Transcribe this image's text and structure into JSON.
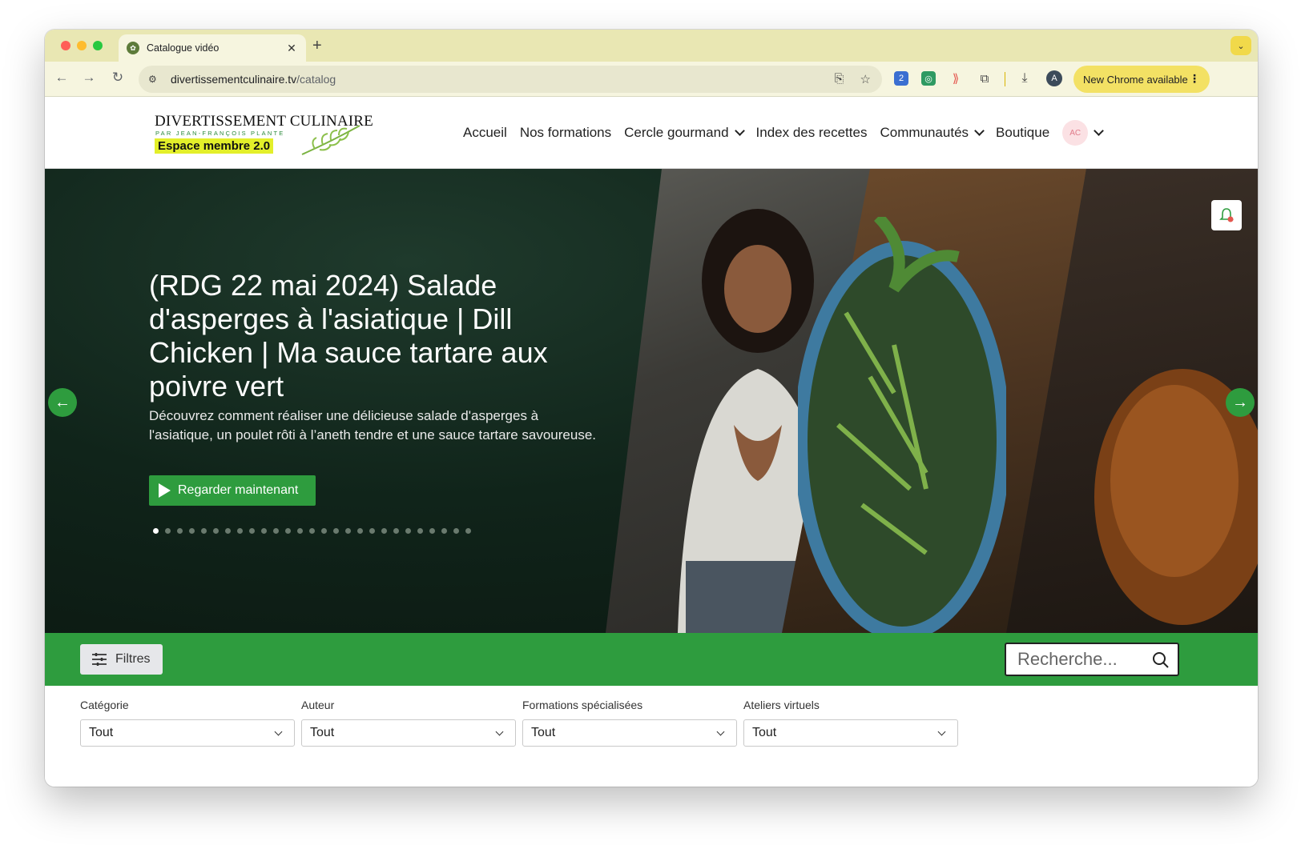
{
  "browser": {
    "tab_title": "Catalogue vidéo",
    "url_host": "divertissementculinaire.tv",
    "url_path": "/catalog",
    "update_label": "New Chrome available",
    "profile_initial": "A",
    "extension_badge": "2"
  },
  "site": {
    "logo": {
      "title": "DIVERTISSEMENT CULINAIRE",
      "subtitle": "PAR JEAN-FRANÇOIS PLANTE",
      "badge": "Espace membre 2.0"
    },
    "nav": {
      "home": "Accueil",
      "courses": "Nos formations",
      "gourmet_circle": "Cercle gourmand",
      "recipes_index": "Index des recettes",
      "communities": "Communautés",
      "shop": "Boutique",
      "avatar_initials": "AC"
    }
  },
  "hero": {
    "title": "(RDG 22 mai 2024) Salade d'asperges à l'asiatique | Dill Chicken | Ma sauce tartare aux poivre vert",
    "description": "Découvrez comment réaliser une délicieuse salade d'asperges à l'asiatique, un poulet rôti à l’aneth tendre et une sauce tartare savoureuse.",
    "cta_label": "Regarder maintenant",
    "slide_count": 27,
    "active_slide": 1
  },
  "filter_bar": {
    "filters_label": "Filtres",
    "search_placeholder": "Recherche..."
  },
  "dropdowns": [
    {
      "label": "Catégorie",
      "value": "Tout"
    },
    {
      "label": "Auteur",
      "value": "Tout"
    },
    {
      "label": "Formations spécialisées",
      "value": "Tout"
    },
    {
      "label": "Ateliers virtuels",
      "value": "Tout"
    }
  ],
  "colors": {
    "brand_green": "#2e9c3e",
    "logo_highlight": "#e3ef2a",
    "tabstrip": "#e9e7b3"
  }
}
